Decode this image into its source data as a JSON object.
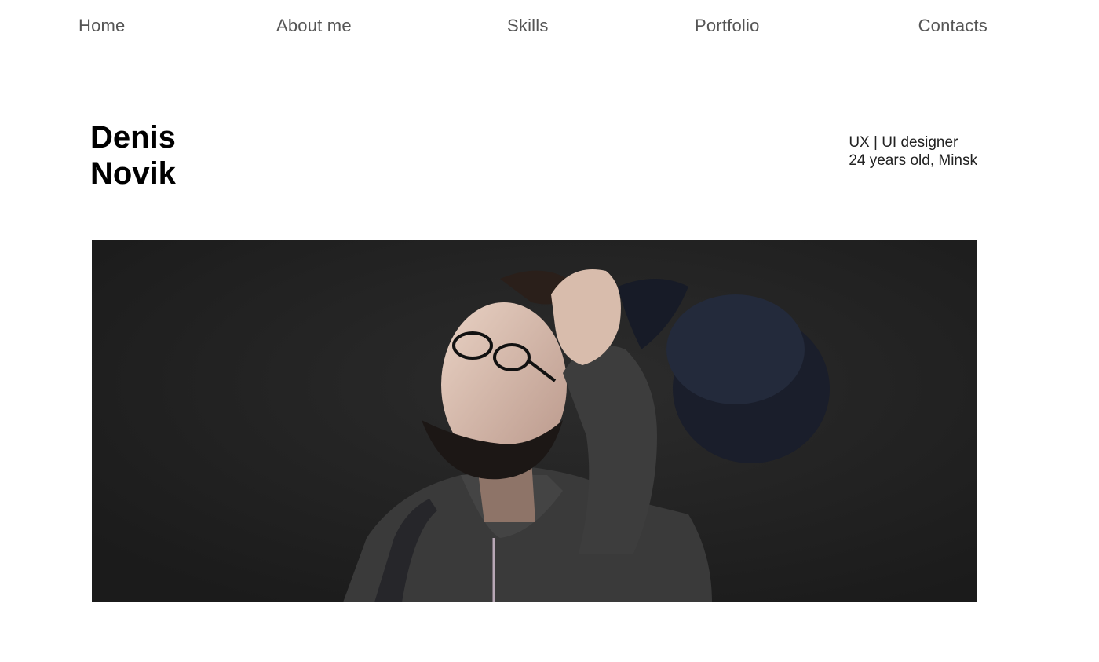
{
  "nav": {
    "items": [
      {
        "label": "Home"
      },
      {
        "label": "About me"
      },
      {
        "label": "Skills"
      },
      {
        "label": "Portfolio"
      },
      {
        "label": "Contacts"
      }
    ]
  },
  "hero": {
    "first_name": "Denis",
    "last_name": "Novik",
    "role": "UX | UI designer",
    "details": "24 years old, Minsk"
  },
  "photo": {
    "background_color": "#232323"
  }
}
